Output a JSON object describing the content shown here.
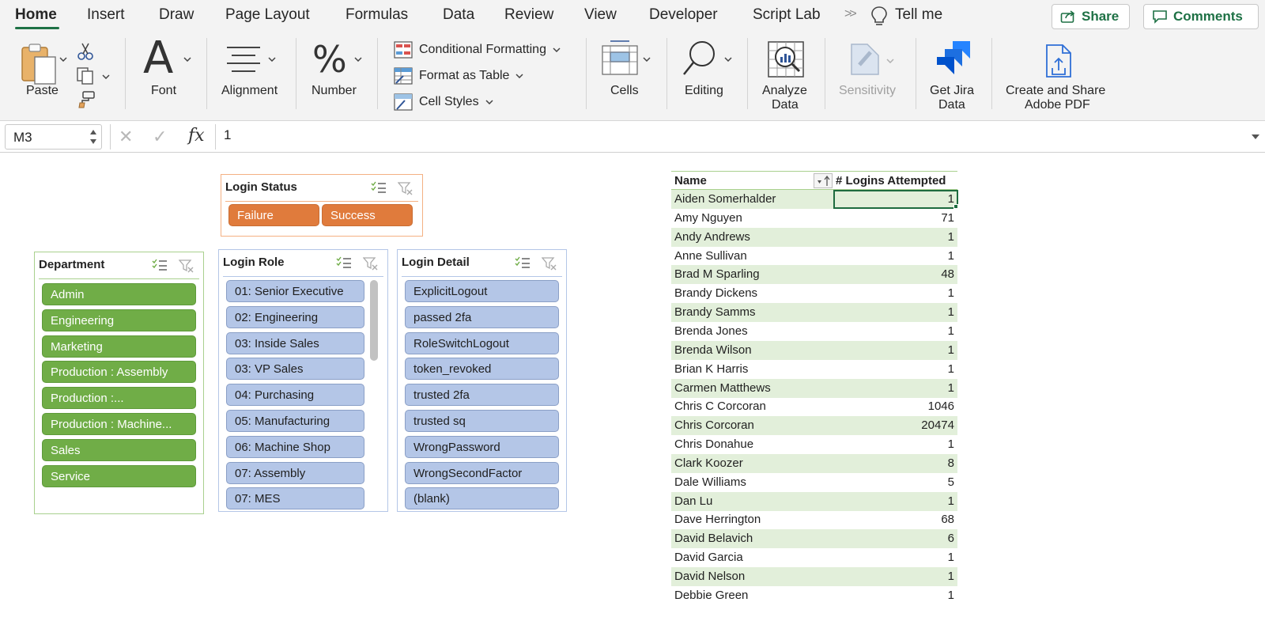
{
  "tabs": {
    "home": "Home",
    "insert": "Insert",
    "draw": "Draw",
    "page_layout": "Page Layout",
    "formulas": "Formulas",
    "data": "Data",
    "review": "Review",
    "view": "View",
    "developer": "Developer",
    "script_lab": "Script Lab",
    "more": ">>",
    "tell_me": "Tell me"
  },
  "top_buttons": {
    "share": "Share",
    "comments": "Comments"
  },
  "ribbon": {
    "paste": "Paste",
    "font": "Font",
    "alignment": "Alignment",
    "number": "Number",
    "conditional_formatting": "Conditional Formatting",
    "format_as_table": "Format as Table",
    "cell_styles": "Cell Styles",
    "cells": "Cells",
    "editing": "Editing",
    "analyze_data_1": "Analyze",
    "analyze_data_2": "Data",
    "sensitivity": "Sensitivity",
    "get_jira_1": "Get Jira",
    "get_jira_2": "Data",
    "adobe_1": "Create and Share",
    "adobe_2": "Adobe PDF",
    "number_glyph": "%",
    "font_glyph": "A"
  },
  "formula_bar": {
    "name_box": "M3",
    "fx": "fx",
    "value": "1"
  },
  "slicers": {
    "login_status": {
      "title": "Login Status",
      "items": [
        "Failure",
        "Success"
      ]
    },
    "department": {
      "title": "Department",
      "items": [
        "Admin",
        "Engineering",
        "Marketing",
        "Production : Assembly",
        "Production :...",
        "Production : Machine...",
        "Sales",
        "Service"
      ]
    },
    "login_role": {
      "title": "Login Role",
      "items": [
        "01: Senior Executive",
        "02: Engineering",
        "03: Inside Sales",
        "03: VP Sales",
        "04: Purchasing",
        "05: Manufacturing",
        "06: Machine Shop",
        "07: Assembly",
        "07: MES"
      ]
    },
    "login_detail": {
      "title": "Login Detail",
      "items": [
        "ExplicitLogout",
        "passed 2fa",
        "RoleSwitchLogout",
        "token_revoked",
        "trusted 2fa",
        "trusted sq",
        "WrongPassword",
        "WrongSecondFactor",
        "(blank)"
      ]
    }
  },
  "pivot": {
    "header_name": "Name",
    "header_value": "# Logins Attempted",
    "rows": [
      {
        "name": "Aiden Somerhalder",
        "value": "1"
      },
      {
        "name": "Amy Nguyen",
        "value": "71"
      },
      {
        "name": "Andy Andrews",
        "value": "1"
      },
      {
        "name": "Anne Sullivan",
        "value": "1"
      },
      {
        "name": "Brad M Sparling",
        "value": "48"
      },
      {
        "name": "Brandy Dickens",
        "value": "1"
      },
      {
        "name": "Brandy Samms",
        "value": "1"
      },
      {
        "name": "Brenda Jones",
        "value": "1"
      },
      {
        "name": "Brenda Wilson",
        "value": "1"
      },
      {
        "name": "Brian K Harris",
        "value": "1"
      },
      {
        "name": "Carmen Matthews",
        "value": "1"
      },
      {
        "name": "Chris C Corcoran",
        "value": "1046"
      },
      {
        "name": "Chris Corcoran",
        "value": "20474"
      },
      {
        "name": "Chris Donahue",
        "value": "1"
      },
      {
        "name": "Clark Koozer",
        "value": "8"
      },
      {
        "name": "Dale Williams",
        "value": "5"
      },
      {
        "name": "Dan Lu",
        "value": "1"
      },
      {
        "name": "Dave Herrington",
        "value": "68"
      },
      {
        "name": "David Belavich",
        "value": "6"
      },
      {
        "name": "David Garcia",
        "value": "1"
      },
      {
        "name": "David Nelson",
        "value": "1"
      },
      {
        "name": "Debbie Green",
        "value": "1"
      }
    ]
  },
  "colors": {
    "excel_green": "#1e7145",
    "slicer_green": "#70ad47",
    "slicer_orange": "#e07b3c",
    "slicer_blue": "#b4c6e7",
    "pivot_band": "#e2efda"
  }
}
